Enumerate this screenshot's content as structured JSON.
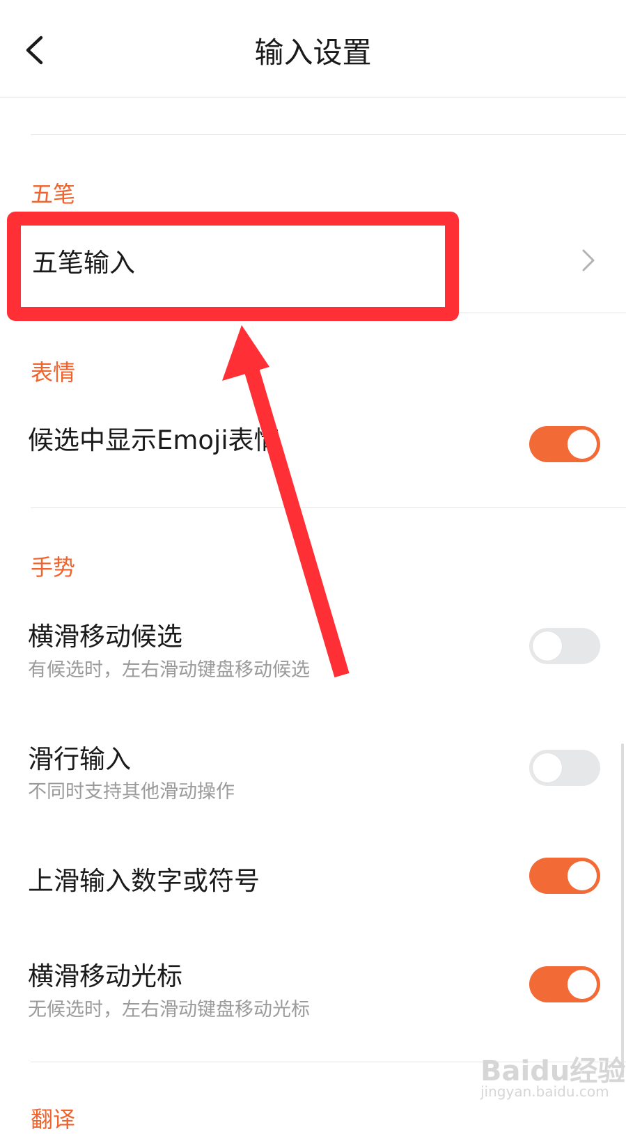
{
  "header": {
    "title": "输入设置",
    "back_icon": "back-arrow-icon"
  },
  "sections": {
    "wubi": {
      "label": "五笔",
      "item": {
        "title": "五笔输入",
        "icon": "chevron-right-icon"
      }
    },
    "emoji": {
      "label": "表情",
      "item": {
        "title": "候选中显示Emoji表情",
        "toggle": "on"
      }
    },
    "gesture": {
      "label": "手势",
      "items": [
        {
          "title": "横滑移动候选",
          "subtitle": "有候选时，左右滑动键盘移动候选",
          "toggle": "off"
        },
        {
          "title": "滑行输入",
          "subtitle": "不同时支持其他滑动操作",
          "toggle": "off"
        },
        {
          "title": "上滑输入数字或符号",
          "toggle": "on"
        },
        {
          "title": "横滑移动光标",
          "subtitle": "无候选时，左右滑动键盘移动光标",
          "toggle": "on"
        }
      ]
    },
    "translate": {
      "label": "翻译"
    }
  },
  "colors": {
    "accent": "#f26a35",
    "section_label": "#f0632d",
    "annotation": "#ff2f36"
  },
  "watermark": {
    "logo": "Baidu经验",
    "url": "jingyan.baidu.com"
  }
}
